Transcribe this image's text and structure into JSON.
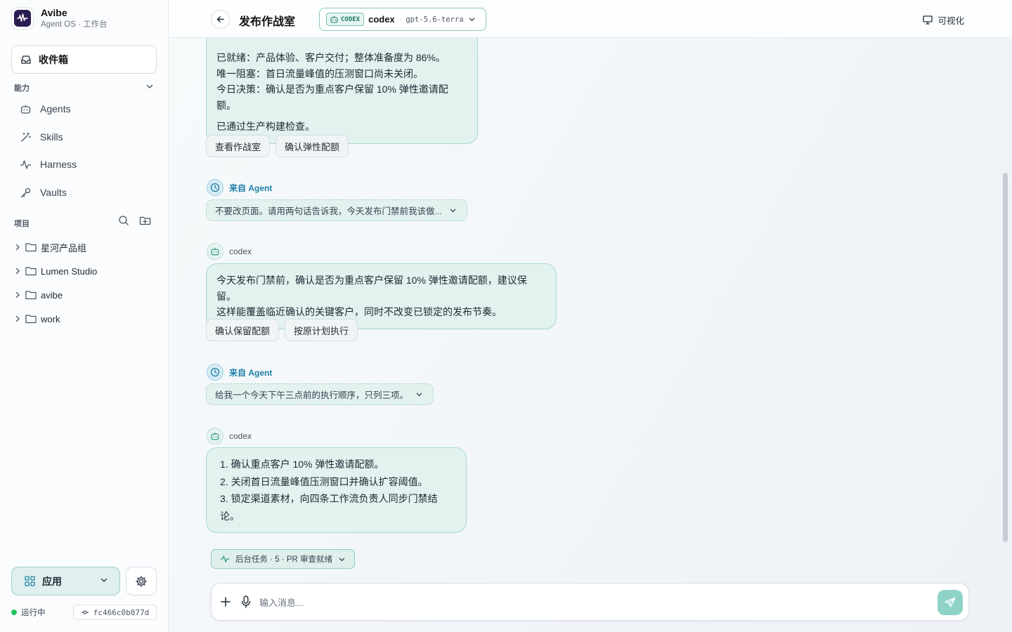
{
  "brand": {
    "name": "Avibe",
    "subtitle": "Agent OS · 工作台"
  },
  "sidebar": {
    "inbox_label": "收件箱",
    "capabilities_heading": "能力",
    "nav": [
      {
        "label": "Agents",
        "icon": "robot-icon"
      },
      {
        "label": "Skills",
        "icon": "wand-icon"
      },
      {
        "label": "Harness",
        "icon": "activity-icon"
      },
      {
        "label": "Vaults",
        "icon": "key-icon"
      }
    ],
    "projects_heading": "项目",
    "projects": [
      {
        "label": "星河产品组"
      },
      {
        "label": "Lumen Studio"
      },
      {
        "label": "avibe"
      },
      {
        "label": "work"
      }
    ],
    "apps_label": "应用",
    "status_label": "运行中",
    "commit_hash": "fc466c0b077d"
  },
  "header": {
    "title": "发布作战室",
    "model_badge": "CODEX",
    "model_name": "codex",
    "model_separator": "·",
    "model_version": "gpt-5.6-terra",
    "visualize_label": "可视化"
  },
  "chat": {
    "message1": {
      "lines": [
        "已就绪：产品体验、客户交付；整体准备度为 86%。",
        "唯一阻塞：首日流量峰值的压测窗口尚未关闭。",
        "今日决策：确认是否为重点客户保留 10% 弹性邀请配额。"
      ],
      "footer": "已通过生产构建检查。",
      "actions": [
        "查看作战室",
        "确认弹性配额"
      ]
    },
    "from_agent_label": "来自 Agent",
    "agent_name": "codex",
    "prompt1": "不要改页面。请用两句话告诉我，今天发布门禁前我该做...",
    "message2": {
      "lines": [
        "今天发布门禁前，确认是否为重点客户保留 10% 弹性邀请配额，建议保留。",
        "这样能覆盖临近确认的关键客户，同时不改变已锁定的发布节奏。"
      ],
      "actions": [
        "确认保留配额",
        "按原计划执行"
      ]
    },
    "prompt2": "给我一个今天下午三点前的执行顺序，只列三项。",
    "message3": {
      "steps": [
        "1. 确认重点客户 10% 弹性邀请配额。",
        "2. 关闭首日流量峰值压测窗口并确认扩容阈值。",
        "3. 锁定渠道素材，向四条工作流负责人同步门禁结论。"
      ]
    }
  },
  "background_tasks": {
    "label": "后台任务 · 5 · PR 审查就绪"
  },
  "composer": {
    "placeholder": "输入消息..."
  },
  "colors": {
    "accent": "#8ec9bf",
    "bubble": "#e1f2ef",
    "from_agent": "#1e7fa8",
    "status_ok": "#22c55e"
  }
}
